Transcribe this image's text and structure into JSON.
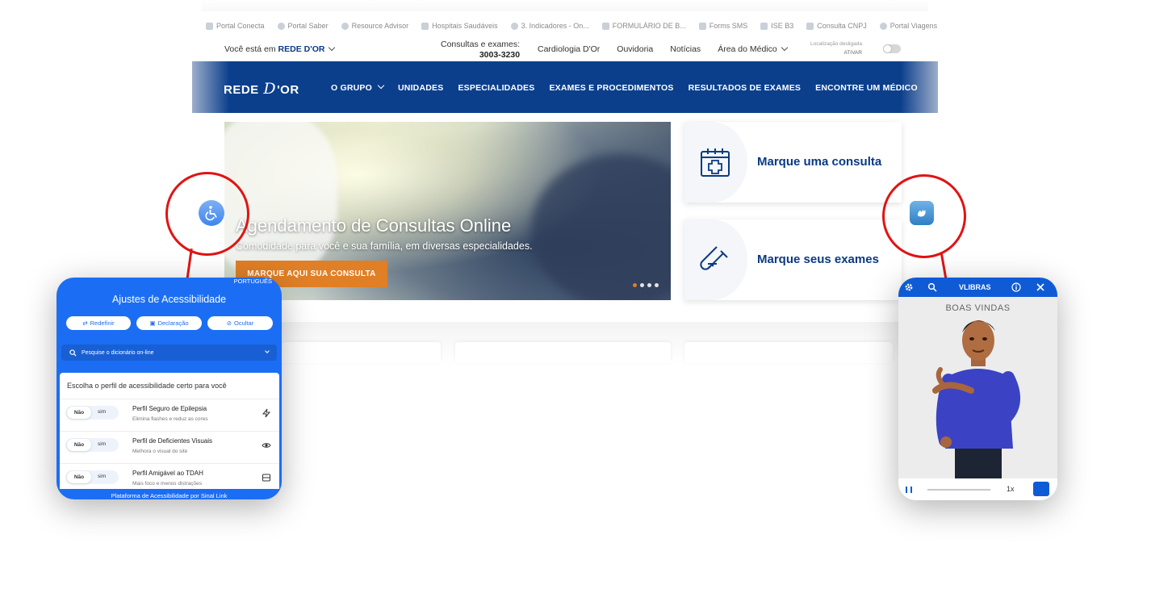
{
  "bookmarks": [
    "Portal Conecta",
    "Portal Saber",
    "Resource Advisor",
    "Hospitais Saudáveis",
    "3. Indicadores - On...",
    "FORMULÁRIO DE B...",
    "Forms SMS",
    "ISE B3",
    "Consulta CNPJ",
    "Portal Viagens"
  ],
  "utility": {
    "location_prefix": "Você está em ",
    "location": "REDE D'OR",
    "phone_label": "Consultas e exames:",
    "phone": "3003-3230",
    "links": [
      "Cardiologia D'Or",
      "Ouvidoria",
      "Notícias",
      "Área do Médico"
    ],
    "geo_label": "Localização desligada",
    "geo_action": "ATIVAR"
  },
  "nav": {
    "logo_left": "REDE ",
    "logo_d": "D",
    "logo_right": "'OR",
    "items": [
      "O GRUPO",
      "UNIDADES",
      "ESPECIALIDADES",
      "EXAMES E PROCEDIMENTOS",
      "RESULTADOS DE EXAMES",
      "ENCONTRE UM MÉDICO"
    ]
  },
  "hero": {
    "title": "Agendamento de Consultas Online",
    "subtitle": "Comodidade para você e sua família, em diversas especialidades.",
    "cta": "MARQUE AQUI SUA CONSULTA",
    "slide_count": 4,
    "active_slide": 1
  },
  "cards": [
    {
      "label": "Marque uma consulta",
      "icon": "calendar-medical-icon"
    },
    {
      "label": "Marque seus exames",
      "icon": "test-tube-icon"
    }
  ],
  "accessibility": {
    "language": "PORTUGUÊS",
    "title": "Ajustes de Acessibilidade",
    "buttons": [
      "Redefinir",
      "Declaração",
      "Ocultar"
    ],
    "search_placeholder": "Pesquise o dicionário on-line",
    "profile_heading": "Escolha o perfil de acessibilidade certo para você",
    "toggle_no": "Não",
    "toggle_yes": "sim",
    "profiles": [
      {
        "title": "Perfil Seguro de Epilepsia",
        "desc": "Elimina flashes e reduz as cores",
        "icon": "bolt-icon"
      },
      {
        "title": "Perfil de Deficientes Visuais",
        "desc": "Melhora o visual do site",
        "icon": "eye-icon"
      },
      {
        "title": "Perfil Amigável ao TDAH",
        "desc": "Mais foco e menos distrações",
        "icon": "focus-icon"
      }
    ],
    "footer": "Plataforma de Acessibilidade por Sinal Link"
  },
  "vlibras": {
    "title": "VLIBRAS",
    "greeting": "BOAS VINDAS",
    "speed": "1x"
  },
  "colors": {
    "nav_blue": "#0b3f8c",
    "accent_orange": "#e07f25",
    "panel_blue": "#1b6ef3",
    "callout_red": "#e01414"
  }
}
